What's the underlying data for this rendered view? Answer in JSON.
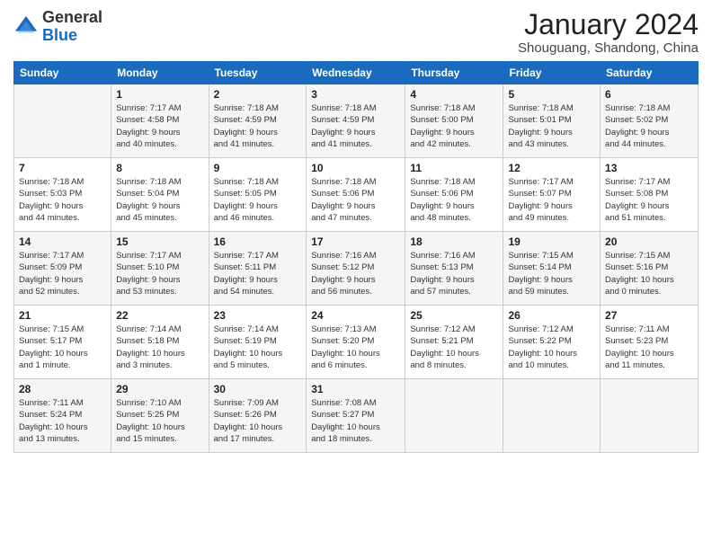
{
  "logo": {
    "general": "General",
    "blue": "Blue"
  },
  "title": "January 2024",
  "location": "Shouguang, Shandong, China",
  "days_header": [
    "Sunday",
    "Monday",
    "Tuesday",
    "Wednesday",
    "Thursday",
    "Friday",
    "Saturday"
  ],
  "weeks": [
    [
      {
        "day": "",
        "info": ""
      },
      {
        "day": "1",
        "info": "Sunrise: 7:17 AM\nSunset: 4:58 PM\nDaylight: 9 hours\nand 40 minutes."
      },
      {
        "day": "2",
        "info": "Sunrise: 7:18 AM\nSunset: 4:59 PM\nDaylight: 9 hours\nand 41 minutes."
      },
      {
        "day": "3",
        "info": "Sunrise: 7:18 AM\nSunset: 4:59 PM\nDaylight: 9 hours\nand 41 minutes."
      },
      {
        "day": "4",
        "info": "Sunrise: 7:18 AM\nSunset: 5:00 PM\nDaylight: 9 hours\nand 42 minutes."
      },
      {
        "day": "5",
        "info": "Sunrise: 7:18 AM\nSunset: 5:01 PM\nDaylight: 9 hours\nand 43 minutes."
      },
      {
        "day": "6",
        "info": "Sunrise: 7:18 AM\nSunset: 5:02 PM\nDaylight: 9 hours\nand 44 minutes."
      }
    ],
    [
      {
        "day": "7",
        "info": "Sunrise: 7:18 AM\nSunset: 5:03 PM\nDaylight: 9 hours\nand 44 minutes."
      },
      {
        "day": "8",
        "info": "Sunrise: 7:18 AM\nSunset: 5:04 PM\nDaylight: 9 hours\nand 45 minutes."
      },
      {
        "day": "9",
        "info": "Sunrise: 7:18 AM\nSunset: 5:05 PM\nDaylight: 9 hours\nand 46 minutes."
      },
      {
        "day": "10",
        "info": "Sunrise: 7:18 AM\nSunset: 5:06 PM\nDaylight: 9 hours\nand 47 minutes."
      },
      {
        "day": "11",
        "info": "Sunrise: 7:18 AM\nSunset: 5:06 PM\nDaylight: 9 hours\nand 48 minutes."
      },
      {
        "day": "12",
        "info": "Sunrise: 7:17 AM\nSunset: 5:07 PM\nDaylight: 9 hours\nand 49 minutes."
      },
      {
        "day": "13",
        "info": "Sunrise: 7:17 AM\nSunset: 5:08 PM\nDaylight: 9 hours\nand 51 minutes."
      }
    ],
    [
      {
        "day": "14",
        "info": "Sunrise: 7:17 AM\nSunset: 5:09 PM\nDaylight: 9 hours\nand 52 minutes."
      },
      {
        "day": "15",
        "info": "Sunrise: 7:17 AM\nSunset: 5:10 PM\nDaylight: 9 hours\nand 53 minutes."
      },
      {
        "day": "16",
        "info": "Sunrise: 7:17 AM\nSunset: 5:11 PM\nDaylight: 9 hours\nand 54 minutes."
      },
      {
        "day": "17",
        "info": "Sunrise: 7:16 AM\nSunset: 5:12 PM\nDaylight: 9 hours\nand 56 minutes."
      },
      {
        "day": "18",
        "info": "Sunrise: 7:16 AM\nSunset: 5:13 PM\nDaylight: 9 hours\nand 57 minutes."
      },
      {
        "day": "19",
        "info": "Sunrise: 7:15 AM\nSunset: 5:14 PM\nDaylight: 9 hours\nand 59 minutes."
      },
      {
        "day": "20",
        "info": "Sunrise: 7:15 AM\nSunset: 5:16 PM\nDaylight: 10 hours\nand 0 minutes."
      }
    ],
    [
      {
        "day": "21",
        "info": "Sunrise: 7:15 AM\nSunset: 5:17 PM\nDaylight: 10 hours\nand 1 minute."
      },
      {
        "day": "22",
        "info": "Sunrise: 7:14 AM\nSunset: 5:18 PM\nDaylight: 10 hours\nand 3 minutes."
      },
      {
        "day": "23",
        "info": "Sunrise: 7:14 AM\nSunset: 5:19 PM\nDaylight: 10 hours\nand 5 minutes."
      },
      {
        "day": "24",
        "info": "Sunrise: 7:13 AM\nSunset: 5:20 PM\nDaylight: 10 hours\nand 6 minutes."
      },
      {
        "day": "25",
        "info": "Sunrise: 7:12 AM\nSunset: 5:21 PM\nDaylight: 10 hours\nand 8 minutes."
      },
      {
        "day": "26",
        "info": "Sunrise: 7:12 AM\nSunset: 5:22 PM\nDaylight: 10 hours\nand 10 minutes."
      },
      {
        "day": "27",
        "info": "Sunrise: 7:11 AM\nSunset: 5:23 PM\nDaylight: 10 hours\nand 11 minutes."
      }
    ],
    [
      {
        "day": "28",
        "info": "Sunrise: 7:11 AM\nSunset: 5:24 PM\nDaylight: 10 hours\nand 13 minutes."
      },
      {
        "day": "29",
        "info": "Sunrise: 7:10 AM\nSunset: 5:25 PM\nDaylight: 10 hours\nand 15 minutes."
      },
      {
        "day": "30",
        "info": "Sunrise: 7:09 AM\nSunset: 5:26 PM\nDaylight: 10 hours\nand 17 minutes."
      },
      {
        "day": "31",
        "info": "Sunrise: 7:08 AM\nSunset: 5:27 PM\nDaylight: 10 hours\nand 18 minutes."
      },
      {
        "day": "",
        "info": ""
      },
      {
        "day": "",
        "info": ""
      },
      {
        "day": "",
        "info": ""
      }
    ]
  ]
}
